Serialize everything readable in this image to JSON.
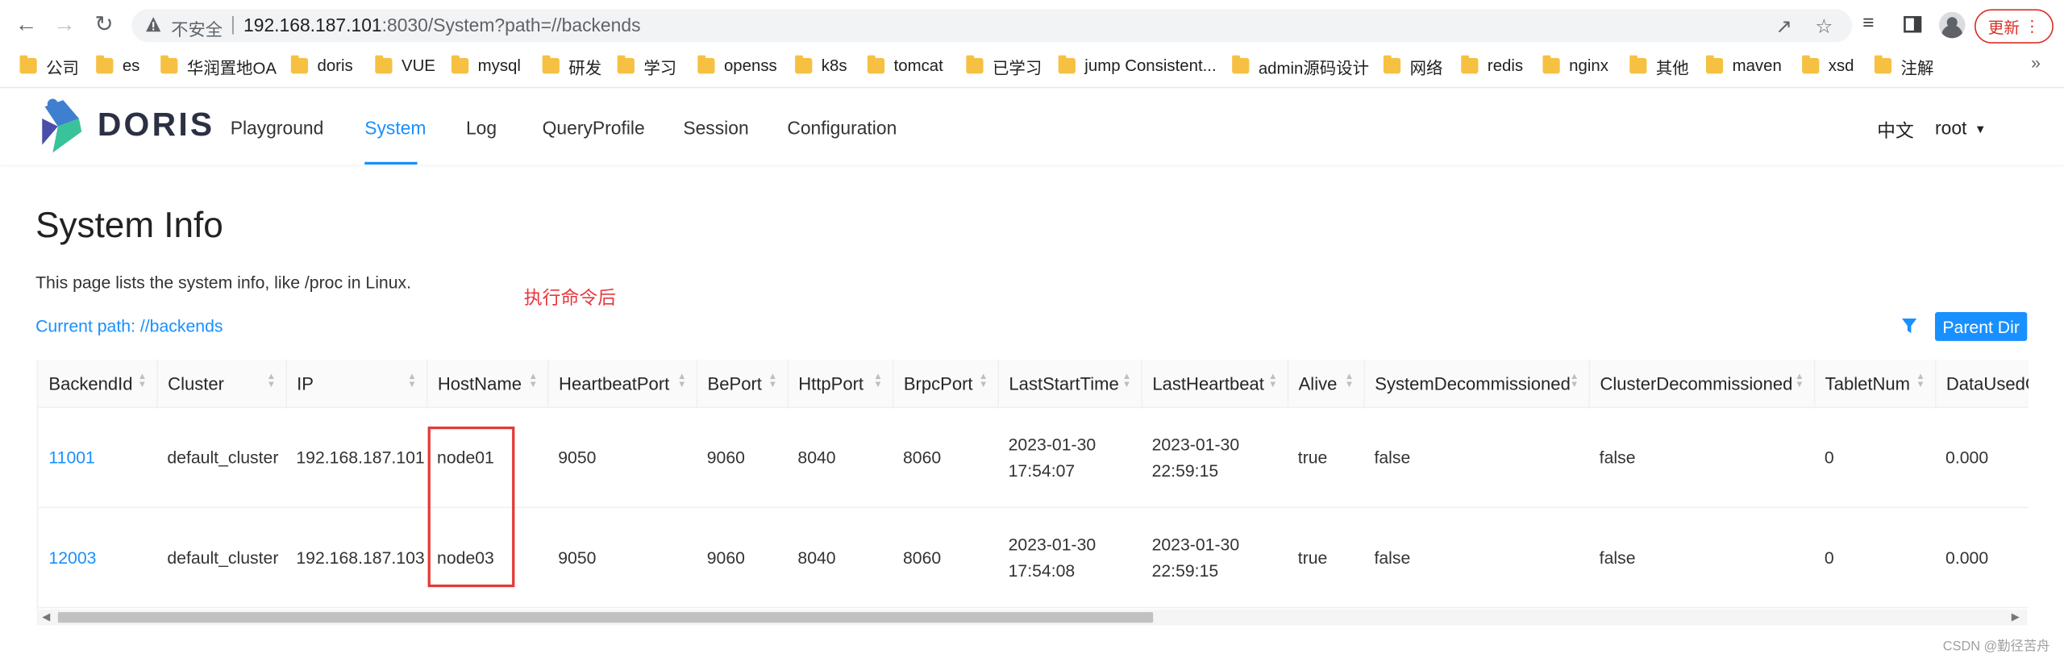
{
  "browser": {
    "insecure_label": "不安全",
    "url_host": "192.168.187.101",
    "url_rest": ":8030/System?path=//backends",
    "update_label": "更新"
  },
  "bookmarks": [
    "公司",
    "es",
    "华润置地OA",
    "doris",
    "VUE",
    "mysql",
    "研发",
    "学习",
    "openss",
    "k8s",
    "tomcat",
    "已学习",
    "jump Consistent...",
    "admin源码设计",
    "网络",
    "redis",
    "nginx",
    "其他",
    "maven",
    "xsd",
    "注解"
  ],
  "app": {
    "logo_text": "DORIS",
    "menu": [
      "Playground",
      "System",
      "Log",
      "QueryProfile",
      "Session",
      "Configuration"
    ],
    "active_menu": "System",
    "lang": "中文",
    "user": "root"
  },
  "page": {
    "title": "System Info",
    "description": "This page lists the system info, like /proc in Linux.",
    "annotation": "执行命令后",
    "current_path": "Current path: //backends",
    "parent_dir": "Parent Dir"
  },
  "table": {
    "columns": [
      "BackendId",
      "Cluster",
      "IP",
      "HostName",
      "HeartbeatPort",
      "BePort",
      "HttpPort",
      "BrpcPort",
      "LastStartTime",
      "LastHeartbeat",
      "Alive",
      "SystemDecommissioned",
      "ClusterDecommissioned",
      "TabletNum",
      "DataUsedC"
    ],
    "rows": [
      {
        "backend_id": "11001",
        "cluster": "default_cluster",
        "ip": "192.168.187.101",
        "hostname": "node01",
        "heartbeat_port": "9050",
        "be_port": "9060",
        "http_port": "8040",
        "brpc_port": "8060",
        "last_start_date": "2023-01-30",
        "last_start_time": "17:54:07",
        "last_heartbeat_date": "2023-01-30",
        "last_heartbeat_time": "22:59:15",
        "alive": "true",
        "system_decommissioned": "false",
        "cluster_decommissioned": "false",
        "tablet_num": "0",
        "data_used": "0.000"
      },
      {
        "backend_id": "12003",
        "cluster": "default_cluster",
        "ip": "192.168.187.103",
        "hostname": "node03",
        "heartbeat_port": "9050",
        "be_port": "9060",
        "http_port": "8040",
        "brpc_port": "8060",
        "last_start_date": "2023-01-30",
        "last_start_time": "17:54:08",
        "last_heartbeat_date": "2023-01-30",
        "last_heartbeat_time": "22:59:15",
        "alive": "true",
        "system_decommissioned": "false",
        "cluster_decommissioned": "false",
        "tablet_num": "0",
        "data_used": "0.000"
      }
    ]
  },
  "watermark": "CSDN @勤径苦舟",
  "colors": {
    "accent": "#1890ff",
    "annotation": "#e8383d",
    "update": "#d93025"
  }
}
